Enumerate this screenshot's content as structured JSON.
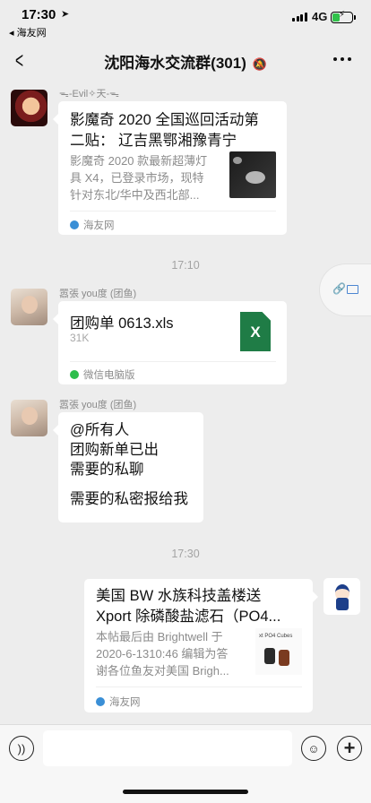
{
  "status_bar": {
    "time": "17:30",
    "back_app": "◂ 海友网",
    "network": "4G",
    "battery_color": "#30c24a"
  },
  "nav": {
    "back_icon": "chevron-left-icon",
    "title": "沈阳海水交流群(301)",
    "mute_icon": "bell-off-icon",
    "more_icon": "more-icon"
  },
  "messages": [
    {
      "sender": "ᯓ-Evil✧天-ᯓ",
      "card": {
        "title": "影魔奇 2020 全国巡回活动第二贴： 辽吉黑鄂湘豫青宁",
        "title_line1": "影魔奇 2020 全国巡回活动第",
        "title_line2": "二贴： 辽吉黑鄂湘豫青宁",
        "desc_line1": "影魔奇 2020 款最新超薄灯",
        "desc_line2": "具 X4，已登录市场，现特",
        "desc_line3": "针对东北/华中及西北部...",
        "source": "海友网"
      }
    },
    {
      "sender": "嚣張 you度 (团鱼)",
      "file": {
        "name": "团购单 0613.xls",
        "size": "31K",
        "icon_label": "X",
        "source": "微信电脑版"
      }
    },
    {
      "sender": "嚣張 you度 (团鱼)",
      "text_lines": [
        "@所有人",
        "团购新单已出",
        "需要的私聊",
        "",
        "需要的私密报给我"
      ]
    },
    {
      "sender": "",
      "card": {
        "title_line1": "美国 BW 水族科技盖楼送",
        "title_line2": "Xport 除磷酸盐滤石（PO4...",
        "desc_line1": "本帖最后由 Brightwell 于",
        "desc_line2": "2020-6-1310:46 编辑为答",
        "desc_line3": "谢各位鱼友对美国 Brigh...",
        "source": "海友网",
        "thumb_text": "xt PO4 Cubes"
      }
    }
  ],
  "timestamps": [
    "17:10",
    "17:30"
  ],
  "input_bar": {
    "voice_icon": "voice-icon",
    "emoji_icon": "emoji-icon",
    "plus_icon": "plus-icon"
  }
}
